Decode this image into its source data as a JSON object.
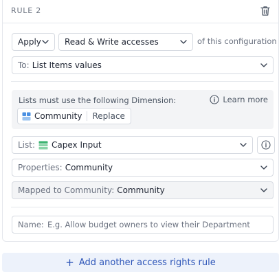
{
  "rule": {
    "title": "RULE 2",
    "apply_label": "Apply",
    "access_label": "Read & Write accesses",
    "suffix_text": "of this configuration",
    "to_label": "To:",
    "to_value": "List Items values",
    "dimension_note": "Lists must use the following Dimension:",
    "learn_more": "Learn more",
    "dimension_chip": "Community",
    "replace_label": "Replace",
    "list_label": "List:",
    "list_value": "Capex Input",
    "properties_label": "Properties:",
    "properties_value": "Community",
    "mapped_label": "Mapped to Community:",
    "mapped_value": "Community",
    "name_label": "Name:",
    "name_placeholder": "E.g. Allow budget owners to view their Department"
  },
  "footer": {
    "add_rule_label": "Add another access rights rule"
  },
  "colors": {
    "accent": "#2d55b8",
    "add_rule_bg": "#edf2fb",
    "dimension_icon": "#4a90e2",
    "list_icon": "#3cb371"
  },
  "icons": {
    "trash": "trash-icon",
    "chevron": "chevron-down-icon",
    "info": "info-icon",
    "dimension": "dimension-icon",
    "list": "list-table-icon",
    "plus": "plus-icon"
  }
}
